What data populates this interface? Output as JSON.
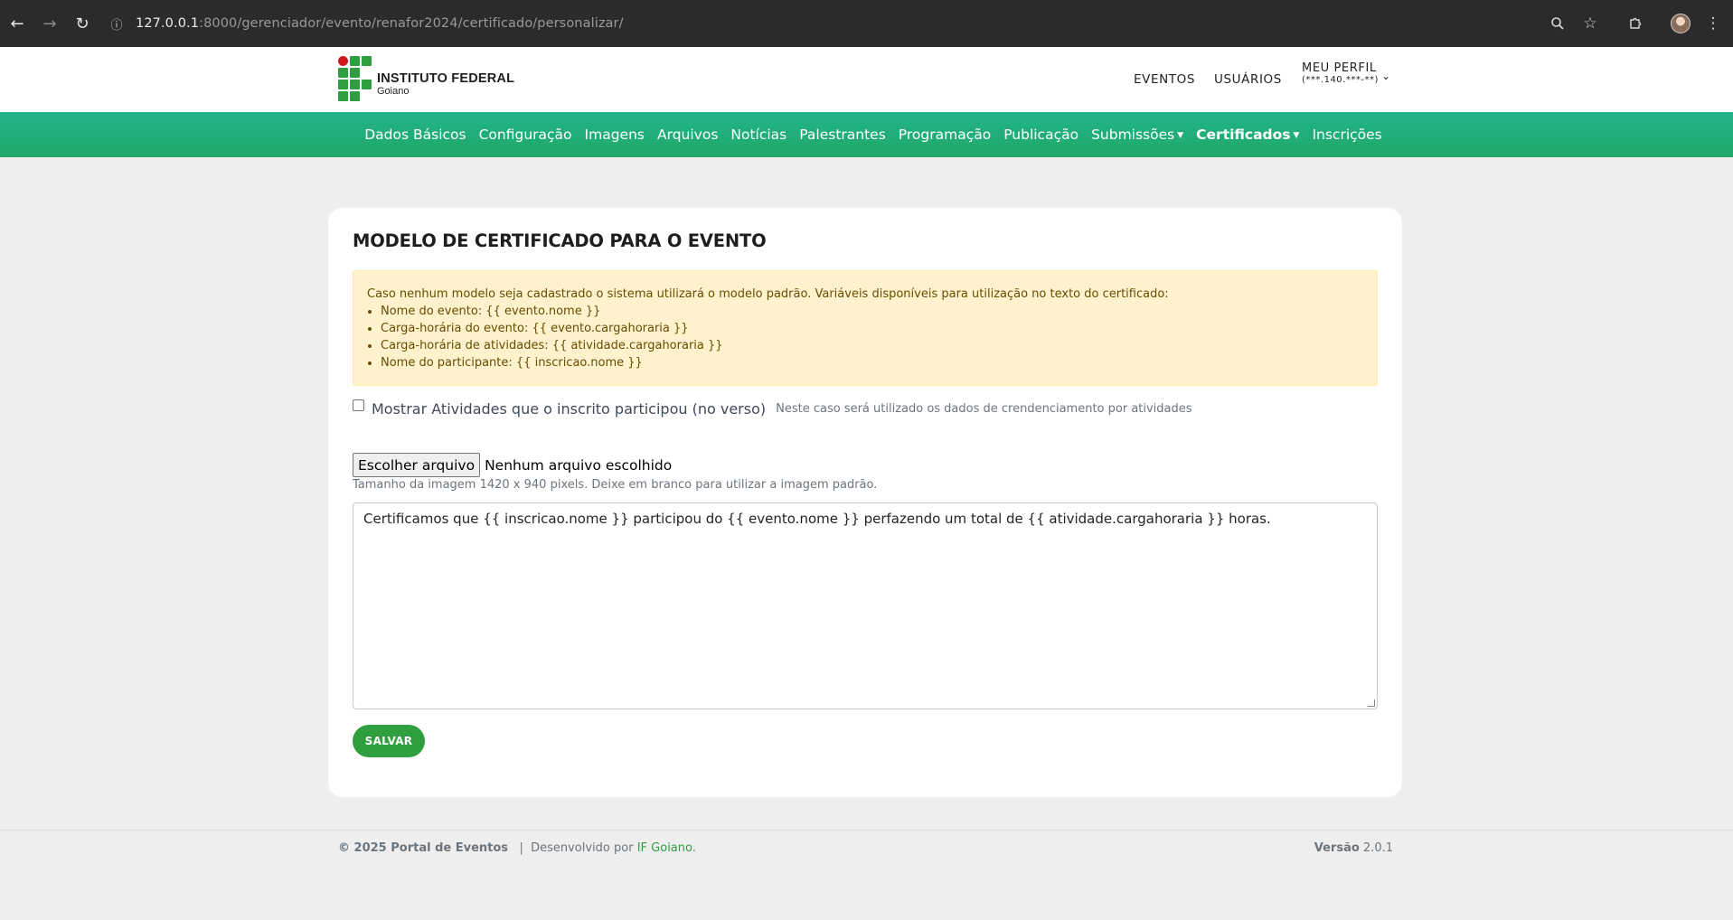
{
  "browser": {
    "url_host": "127.0.0.1",
    "url_rest": ":8000/gerenciador/evento/renafor2024/certificado/personalizar/"
  },
  "header": {
    "logo_title": "INSTITUTO FEDERAL",
    "logo_subtitle": "Goiano",
    "nav_events": "EVENTOS",
    "nav_users": "USUÁRIOS",
    "profile_label": "MEU PERFIL",
    "profile_id": "(***.140.***-**)"
  },
  "subnav": {
    "items": [
      {
        "label": "Dados Básicos"
      },
      {
        "label": "Configuração"
      },
      {
        "label": "Imagens"
      },
      {
        "label": "Arquivos"
      },
      {
        "label": "Notícias"
      },
      {
        "label": "Palestrantes"
      },
      {
        "label": "Programação"
      },
      {
        "label": "Publicação"
      },
      {
        "label": "Submissões"
      },
      {
        "label": "Certificados"
      },
      {
        "label": "Inscrições"
      }
    ]
  },
  "main": {
    "title": "MODELO DE CERTIFICADO PARA O EVENTO",
    "alert_intro": "Caso nenhum modelo seja cadastrado o sistema utilizará o modelo padrão. Variáveis disponíveis para utilização no texto do certificado:",
    "alert_items": [
      "Nome do evento: {{ evento.nome }}",
      "Carga-horária do evento: {{ evento.cargahoraria }}",
      "Carga-horária de atividades: {{ atividade.cargahoraria }}",
      "Nome do participante: {{ inscricao.nome }}"
    ],
    "checkbox_label": "Mostrar Atividades que o inscrito participou (no verso)",
    "checkbox_help": "Neste caso será utilizado os dados de crendenciamento por atividades",
    "checkbox_checked": false,
    "file_button": "Escolher arquivo",
    "file_status": "Nenhum arquivo escolhido",
    "file_help": "Tamanho da imagem 1420 x 940 pixels. Deixe em branco para utilizar a imagem padrão.",
    "textarea_value": "Certificamos que {{ inscricao.nome }} participou do {{ evento.nome }} perfazendo um total de {{ atividade.cargahoraria }} horas.",
    "save_button": "SALVAR"
  },
  "footer": {
    "copyright": "© 2025 Portal de Eventos",
    "separator": "|",
    "developed_by": "Desenvolvido por",
    "developer": "IF Goiano",
    "period": ".",
    "version_label": "Versão",
    "version_value": "2.0.1"
  },
  "colors": {
    "nav_gradient_start": "#22b38c",
    "nav_gradient_end": "#1fa865",
    "brand_green": "#2e9e3f",
    "brand_red": "#cd191e",
    "alert_bg": "#fff2cc"
  },
  "icons": {
    "back": "arrow-left-icon",
    "forward": "arrow-right-icon",
    "reload": "reload-icon",
    "site_info": "info-icon",
    "zoom": "zoom-icon",
    "bookmark": "star-icon",
    "extensions": "puzzle-icon",
    "menu": "kebab-menu-icon",
    "dropdown": "chevron-down-icon"
  }
}
